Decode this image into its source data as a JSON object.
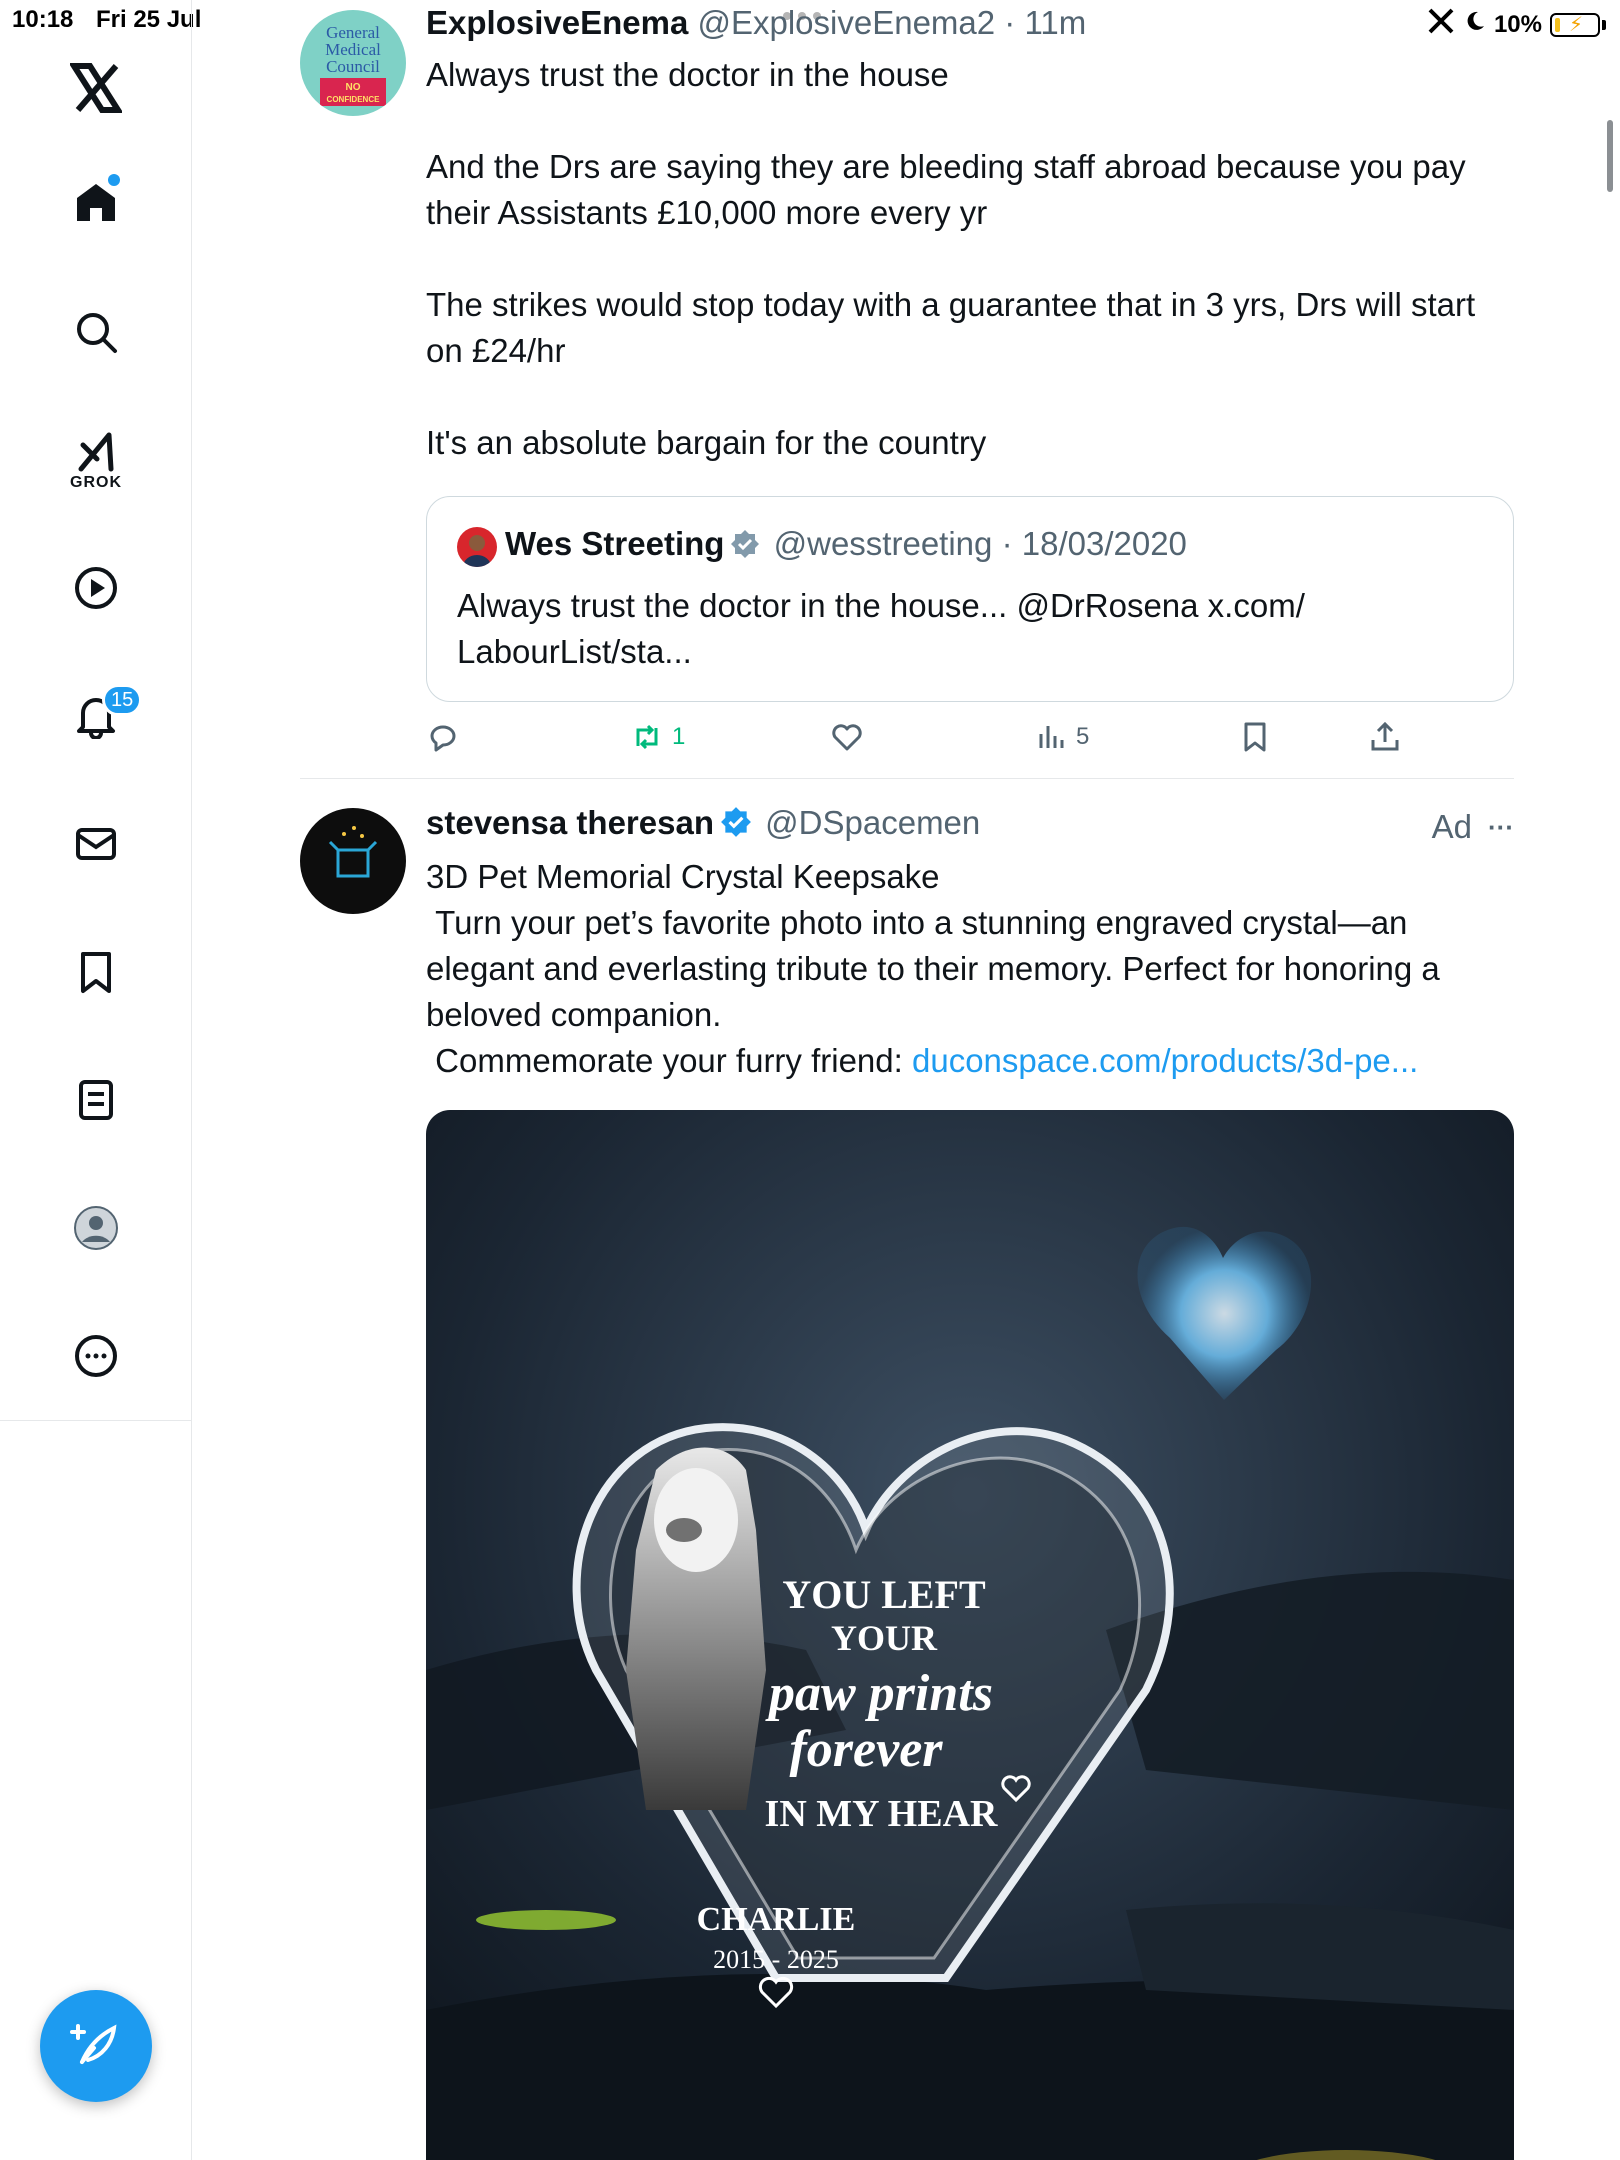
{
  "status_bar": {
    "time": "10:18",
    "date": "Fri 25 Jul",
    "battery": "10%"
  },
  "sidebar": {
    "grok_label": "GROK",
    "notifications_count": "15",
    "items": [
      "home-icon",
      "search-icon",
      "grok-icon",
      "video-icon",
      "notifications-icon",
      "messages-icon",
      "bookmarks-icon",
      "lists-icon",
      "profile-icon",
      "more-icon"
    ]
  },
  "tweet1": {
    "avatar_text": [
      "General",
      "Medical",
      "Council",
      "NO",
      "CONFIDENCE"
    ],
    "name": "ExplosiveEnema",
    "handle": "@ExplosiveEnema2",
    "separator": "·",
    "time": "11m",
    "text": "Always trust the doctor in the house\n\nAnd the Drs are saying they are bleeding staff abroad because you pay their Assistants £10,000 more every yr\n\nThe strikes would stop today with a guarantee that in 3 yrs, Drs will start on £24/hr\n\nIt's an absolute bargain for the country",
    "quote": {
      "name": "Wes Streeting",
      "handle": "@wesstreeting",
      "separator": "·",
      "date": "18/03/2020",
      "text": "Always trust the doctor in the house... @DrRosena x.com/\nLabourList/sta..."
    },
    "actions": {
      "reposts": "1",
      "views": "5"
    }
  },
  "tweet2": {
    "name": "stevensa theresan",
    "handle": "@DSpacemen",
    "ad_label": "Ad",
    "more_label": "···",
    "text_main": "3D Pet Memorial Crystal Keepsake\n Turn your pet’s favorite photo into a stunning engraved crystal—an elegant and everlasting tribute to their memory. Perfect for honoring a beloved companion.\n Commemorate your furry friend: ",
    "link": "duconspace.com/products/3d-pe...",
    "image": {
      "line1": "YOU LEFT",
      "line2": "YOUR",
      "line3": "paw prints",
      "line4": "forever",
      "line5": "IN MY HEAR",
      "pet_name": "CHARLIE",
      "years": "2015 - 2025"
    }
  },
  "colors": {
    "accent": "#1d9bf0",
    "text": "#0f1419",
    "secondary": "#536471",
    "repost_green": "#00ba7c"
  }
}
